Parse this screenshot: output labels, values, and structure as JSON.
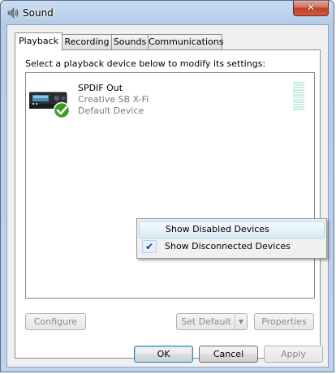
{
  "window": {
    "title": "Sound",
    "close_glyph": "✕"
  },
  "tabs": [
    {
      "label": "Playback"
    },
    {
      "label": "Recording"
    },
    {
      "label": "Sounds"
    },
    {
      "label": "Communications"
    }
  ],
  "instruction": "Select a playback device below to modify its settings:",
  "device": {
    "name": "SPDIF Out",
    "driver": "Creative SB X-Fi",
    "status": "Default Device",
    "icon": "speaker-receiver-icon",
    "status_icon": "green-check-icon"
  },
  "context_menu": {
    "items": [
      {
        "label": "Show Disabled Devices",
        "checked": false
      },
      {
        "label": "Show Disconnected Devices",
        "checked": true,
        "check_glyph": "✔"
      }
    ]
  },
  "panel_buttons": {
    "configure": "Configure",
    "set_default": "Set Default",
    "set_default_arrow": "▼",
    "properties": "Properties"
  },
  "dialog_buttons": {
    "ok": "OK",
    "cancel": "Cancel",
    "apply": "Apply"
  },
  "colors": {
    "title_gradient_top": "#c9dcf2",
    "close_red": "#c0402a",
    "menu_highlight": "#dcecf8",
    "check_blue": "#153b8a",
    "meter_green": "#c9ebe0"
  }
}
